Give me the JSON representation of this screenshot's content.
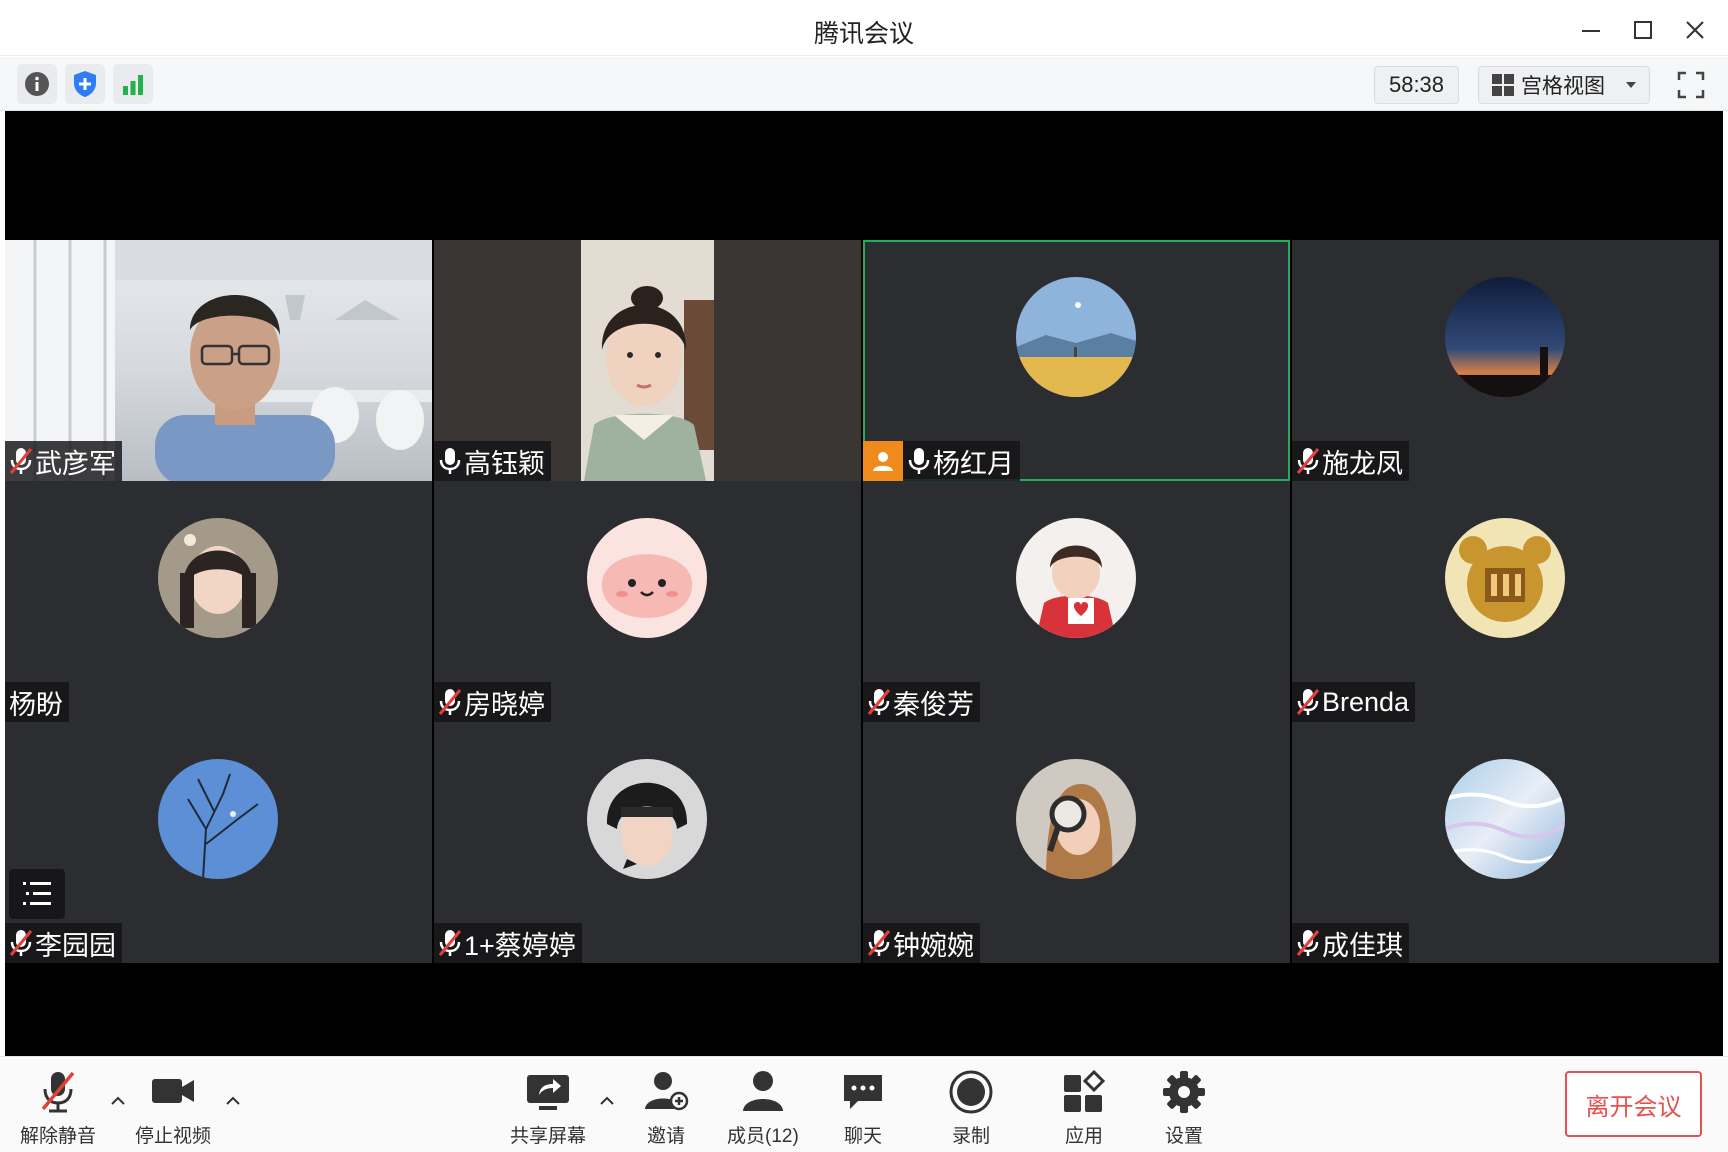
{
  "window": {
    "title": "腾讯会议"
  },
  "toolbar": {
    "icons": [
      "info-icon",
      "shield-icon",
      "signal-icon"
    ],
    "timer": "58:38",
    "view_mode": "宫格视图"
  },
  "participants": [
    {
      "name": "武彦军",
      "mic": "muted",
      "media": "video-office"
    },
    {
      "name": "高钰颖",
      "mic": "on",
      "media": "video-room"
    },
    {
      "name": "杨红月",
      "mic": "on",
      "media": "avatar-landscape",
      "host": true,
      "active": true
    },
    {
      "name": "施龙凤",
      "mic": "muted",
      "media": "avatar-sunset"
    },
    {
      "name": "杨盼",
      "mic": "none",
      "media": "avatar-girl"
    },
    {
      "name": "房晓婷",
      "mic": "muted",
      "media": "avatar-cartoon"
    },
    {
      "name": "秦俊芳",
      "mic": "muted",
      "media": "avatar-child"
    },
    {
      "name": "Brenda",
      "mic": "muted",
      "media": "avatar-bear"
    },
    {
      "name": "李园园",
      "mic": "muted",
      "media": "avatar-tree"
    },
    {
      "name": "1+蔡婷婷",
      "mic": "muted",
      "media": "avatar-helmet"
    },
    {
      "name": "钟婉婉",
      "mic": "muted",
      "media": "avatar-magnifier"
    },
    {
      "name": "成佳琪",
      "mic": "muted",
      "media": "avatar-water"
    }
  ],
  "bottombar": {
    "unmute": "解除静音",
    "stop_video": "停止视频",
    "share_screen": "共享屏幕",
    "invite": "邀请",
    "members": "成员(12)",
    "chat": "聊天",
    "record": "录制",
    "apps": "应用",
    "settings": "设置",
    "leave": "离开会议"
  },
  "colors": {
    "accent": "#2f7cf6",
    "signal": "#22b14c",
    "danger": "#e2534f",
    "host": "#f08a1d",
    "active_border": "#1fae5a"
  }
}
